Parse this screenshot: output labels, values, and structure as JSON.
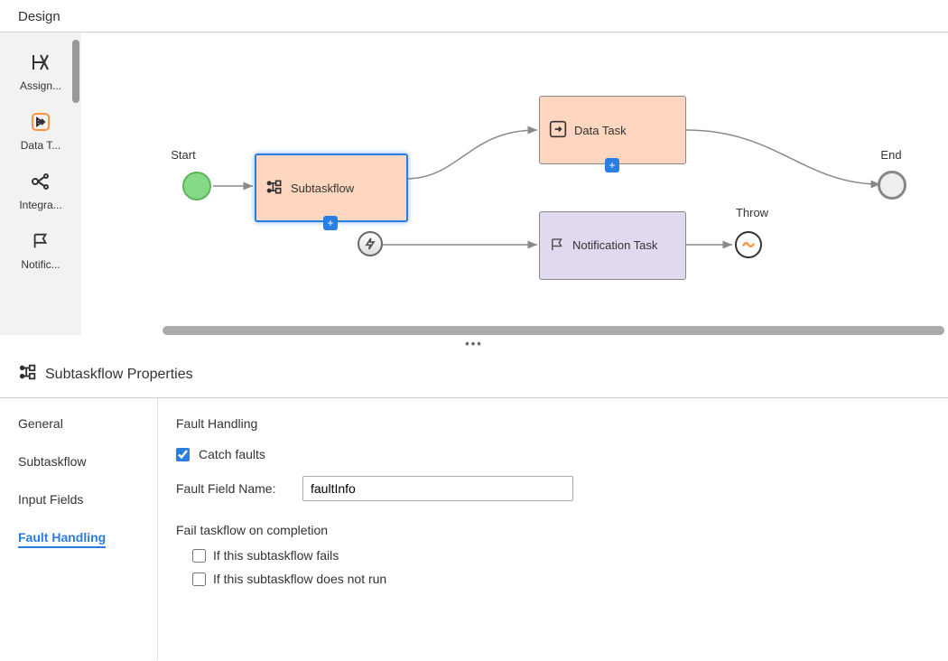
{
  "header": {
    "title": "Design"
  },
  "palette": {
    "items": [
      {
        "label": "Assign...",
        "icon": "assignment-icon"
      },
      {
        "label": "Data T...",
        "icon": "data-task-icon"
      },
      {
        "label": "Integra...",
        "icon": "integration-icon"
      },
      {
        "label": "Notific...",
        "icon": "notification-icon"
      }
    ]
  },
  "canvas": {
    "nodes": {
      "start": {
        "label": "Start"
      },
      "subtaskflow": {
        "label": "Subtaskflow"
      },
      "dataTask": {
        "label": "Data Task"
      },
      "notificationTask": {
        "label": "Notification Task"
      },
      "throw": {
        "label": "Throw"
      },
      "end": {
        "label": "End"
      }
    }
  },
  "properties": {
    "title": "Subtaskflow Properties",
    "tabs": [
      "General",
      "Subtaskflow",
      "Input Fields",
      "Fault Handling"
    ],
    "activeTab": "Fault Handling",
    "faultHandling": {
      "heading": "Fault Handling",
      "catchFaultsLabel": "Catch faults",
      "catchFaultsChecked": true,
      "faultFieldNameLabel": "Fault Field Name:",
      "faultFieldNameValue": "faultInfo",
      "failHeading": "Fail taskflow on completion",
      "failIfFailsLabel": "If this subtaskflow fails",
      "failIfFailsChecked": false,
      "failIfNotRunLabel": "If this subtaskflow does not run",
      "failIfNotRunChecked": false
    }
  }
}
